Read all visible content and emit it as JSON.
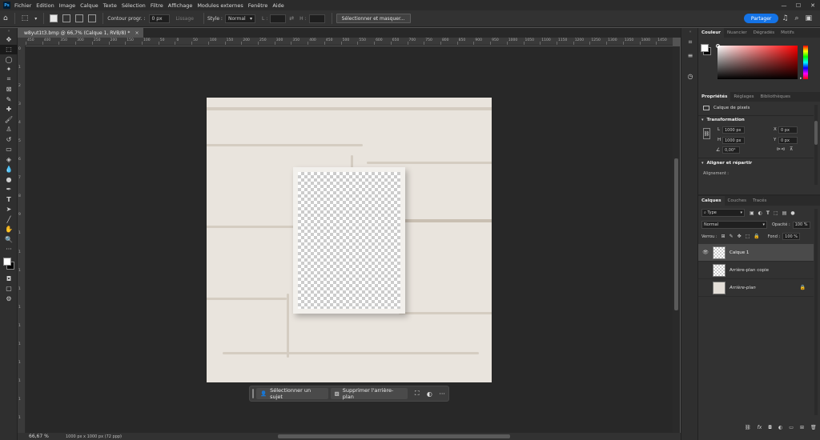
{
  "app": {
    "logo": "Ps"
  },
  "menu": [
    "Fichier",
    "Edition",
    "Image",
    "Calque",
    "Texte",
    "Sélection",
    "Filtre",
    "Affichage",
    "Modules externes",
    "Fenêtre",
    "Aide"
  ],
  "window_controls": {
    "minimize": "—",
    "maximize": "☐",
    "close": "✕"
  },
  "options": {
    "feather_label": "Contour progr. :",
    "feather_value": "0 px",
    "antialias_label": "Lissage",
    "style_label": "Style :",
    "style_value": "Normal",
    "width_label": "L :",
    "height_label": "H :",
    "select_mask_label": "Sélectionner et masquer...",
    "share_label": "Partager"
  },
  "document": {
    "tab_title": "w8yut1t3.bmp @ 66,7% (Calque 1, RVB/8) *",
    "close": "×"
  },
  "ruler": {
    "top": [
      "450",
      "400",
      "350",
      "300",
      "250",
      "200",
      "150",
      "100",
      "50",
      "0",
      "50",
      "100",
      "150",
      "200",
      "250",
      "300",
      "350",
      "400",
      "450",
      "500",
      "550",
      "600",
      "650",
      "700",
      "750",
      "800",
      "850",
      "900",
      "950",
      "1000",
      "1050",
      "1100",
      "1150",
      "1200",
      "1250",
      "1300",
      "1350",
      "1400",
      "1450"
    ],
    "left": [
      "0",
      "1",
      "2",
      "3",
      "4",
      "5",
      "6",
      "7",
      "8",
      "9",
      "1",
      "1",
      "1",
      "1",
      "1",
      "1",
      "1",
      "1",
      "1",
      "1",
      "1"
    ]
  },
  "taskbar": {
    "select_subject": "Sélectionner un sujet",
    "remove_bg": "Supprimer l'arrière-plan",
    "more": "···"
  },
  "status": {
    "zoom": "66,67 %",
    "doc_info": "1000 px x 1000 px (72 ppp)"
  },
  "panels": {
    "color_tabs": [
      "Couleur",
      "Nuancier",
      "Dégradés",
      "Motifs"
    ],
    "props_tabs": [
      "Propriétés",
      "Réglages",
      "Bibliothèques"
    ],
    "pixel_layer": "Calque de pixels",
    "transform_title": "Transformation",
    "transform": {
      "w_label": "L",
      "w_value": "1000 px",
      "h_label": "H",
      "h_value": "1000 px",
      "x_label": "X",
      "x_value": "0 px",
      "y_label": "Y",
      "y_value": "0 px",
      "angle_value": "0,00°"
    },
    "align_title": "Aligner et répartir",
    "align_label": "Alignement :",
    "layers_tabs": [
      "Calques",
      "Couches",
      "Tracés"
    ],
    "kind_label": "Type",
    "blend_mode": "Normal",
    "opacity_label": "Opacité :",
    "opacity_value": "100 %",
    "lock_label": "Verrou :",
    "fill_label": "Fond :",
    "fill_value": "100 %",
    "layers": [
      {
        "name": "Calque 1",
        "visible": true,
        "selected": true
      },
      {
        "name": "Arrière-plan copie",
        "visible": false,
        "selected": false
      },
      {
        "name": "Arrière-plan",
        "visible": false,
        "selected": false,
        "locked": true
      }
    ],
    "footer_icons": [
      "link-icon",
      "fx-icon",
      "mask-icon",
      "adjustment-icon",
      "folder-icon",
      "new-layer-icon",
      "trash-icon"
    ]
  },
  "colors": {
    "accent": "#1473e6",
    "canvas_bg": "#282828",
    "panel_bg": "#323232",
    "wall": "#e9e4dd"
  }
}
